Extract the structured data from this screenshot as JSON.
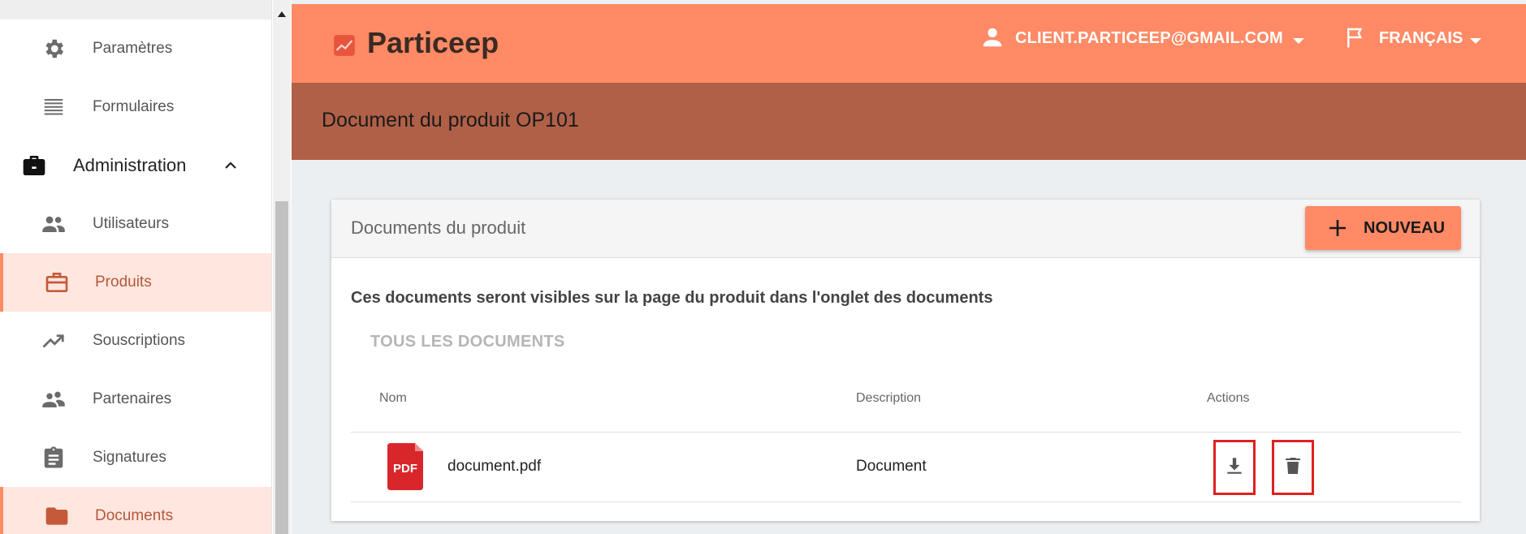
{
  "sidebar": {
    "items": [
      {
        "label": "Paramètres",
        "icon": "gear-icon"
      },
      {
        "label": "Formulaires",
        "icon": "list-icon"
      },
      {
        "label": "Administration",
        "icon": "briefcase-icon"
      },
      {
        "label": "Utilisateurs",
        "icon": "people-icon"
      },
      {
        "label": "Produits",
        "icon": "briefcase-outline-icon"
      },
      {
        "label": "Souscriptions",
        "icon": "trending-up-icon"
      },
      {
        "label": "Partenaires",
        "icon": "partners-icon"
      },
      {
        "label": "Signatures",
        "icon": "clipboard-icon"
      },
      {
        "label": "Documents",
        "icon": "folder-icon"
      }
    ]
  },
  "header": {
    "brand": "Particeep",
    "user_email": "CLIENT.PARTICEEP@GMAIL.COM",
    "language": "FRANÇAIS"
  },
  "page": {
    "title": "Document du produit OP101"
  },
  "card": {
    "title": "Documents du produit",
    "new_button": "NOUVEAU",
    "description": "Ces documents seront visibles sur la page du produit dans l'onglet des documents",
    "tab": "TOUS LES DOCUMENTS",
    "columns": [
      "Nom",
      "Description",
      "Actions"
    ],
    "rows": [
      {
        "file_type": "PDF",
        "name": "document.pdf",
        "description": "Document"
      }
    ]
  },
  "colors": {
    "accent": "#ff8a65",
    "title_bar": "#b06047",
    "active_item_bg": "#ffe7df",
    "highlight_border": "#e02020"
  }
}
